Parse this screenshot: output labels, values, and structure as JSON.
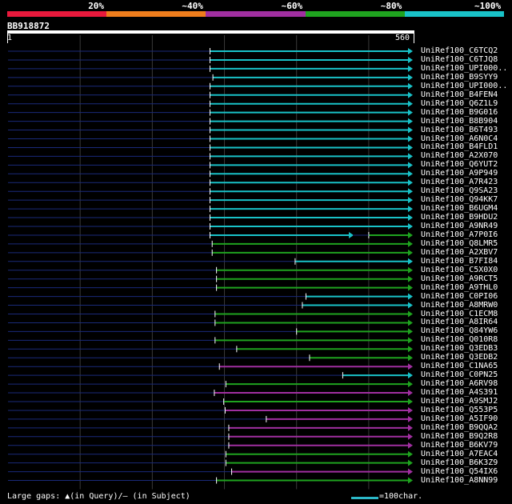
{
  "legend": {
    "colors": [
      "#e8193c",
      "#ee7d1c",
      "#a02fa0",
      "#1fa31f",
      "#19c2c8"
    ],
    "labels": [
      "20%",
      "~40%",
      "~60%",
      "~80%",
      "~100%"
    ]
  },
  "query": {
    "title": "BB918872",
    "start_label": "1",
    "end_label": "560"
  },
  "footer": {
    "gaps_text": "Large gaps: ▲(in Query)/– (in Subject)",
    "scale_text": "=100char."
  },
  "chart_data": {
    "type": "alignment",
    "query_length": 560,
    "grid_positions": [
      100,
      200,
      300,
      400,
      500
    ],
    "hits": [
      {
        "label": "UniRef100_C6TCQ2",
        "start": 280,
        "end": 560,
        "identity": "~100%"
      },
      {
        "label": "UniRef100_C6TJQ8",
        "start": 280,
        "end": 560,
        "identity": "~100%"
      },
      {
        "label": "UniRef100_UPI000..",
        "start": 280,
        "end": 560,
        "identity": "~100%"
      },
      {
        "label": "UniRef100_B9SYY9",
        "start": 284,
        "end": 560,
        "identity": "~100%"
      },
      {
        "label": "UniRef100_UPI000..",
        "start": 280,
        "end": 560,
        "identity": "~100%"
      },
      {
        "label": "UniRef100_B4FEN4",
        "start": 280,
        "end": 560,
        "identity": "~100%"
      },
      {
        "label": "UniRef100_Q6Z1L9",
        "start": 280,
        "end": 560,
        "identity": "~100%"
      },
      {
        "label": "UniRef100_B9G016",
        "start": 280,
        "end": 560,
        "identity": "~100%"
      },
      {
        "label": "UniRef100_B8B904",
        "start": 280,
        "end": 560,
        "identity": "~100%"
      },
      {
        "label": "UniRef100_B6T493",
        "start": 280,
        "end": 560,
        "identity": "~100%"
      },
      {
        "label": "UniRef100_A6N0C4",
        "start": 280,
        "end": 560,
        "identity": "~100%"
      },
      {
        "label": "UniRef100_B4FLD1",
        "start": 280,
        "end": 560,
        "identity": "~100%"
      },
      {
        "label": "UniRef100_A2X070",
        "start": 280,
        "end": 560,
        "identity": "~100%"
      },
      {
        "label": "UniRef100_Q6YUT2",
        "start": 280,
        "end": 560,
        "identity": "~100%"
      },
      {
        "label": "UniRef100_A9P949",
        "start": 280,
        "end": 560,
        "identity": "~100%"
      },
      {
        "label": "UniRef100_A7R423",
        "start": 280,
        "end": 560,
        "identity": "~100%"
      },
      {
        "label": "UniRef100_Q9SA23",
        "start": 280,
        "end": 560,
        "identity": "~100%"
      },
      {
        "label": "UniRef100_Q94KK7",
        "start": 280,
        "end": 560,
        "identity": "~100%"
      },
      {
        "label": "UniRef100_B6UGM4",
        "start": 280,
        "end": 560,
        "identity": "~100%"
      },
      {
        "label": "UniRef100_B9HDU2",
        "start": 280,
        "end": 560,
        "identity": "~100%"
      },
      {
        "label": "UniRef100_A9NR49",
        "start": 280,
        "end": 560,
        "identity": "~100%"
      },
      {
        "label": "UniRef100_A7P0I6",
        "segments": [
          {
            "start": 280,
            "end": 478,
            "identity": "~100%"
          },
          {
            "start": 500,
            "end": 560,
            "identity": "~80%"
          }
        ]
      },
      {
        "label": "UniRef100_Q8LMR5",
        "start": 283,
        "end": 560,
        "identity": "~80%"
      },
      {
        "label": "UniRef100_A2XBV7",
        "start": 283,
        "end": 560,
        "identity": "~80%"
      },
      {
        "label": "UniRef100_B7FI84",
        "start": 398,
        "end": 560,
        "identity": "~100%"
      },
      {
        "label": "UniRef100_C5X0X0",
        "start": 289,
        "end": 560,
        "identity": "~80%"
      },
      {
        "label": "UniRef100_A9RCT5",
        "start": 289,
        "end": 560,
        "identity": "~80%"
      },
      {
        "label": "UniRef100_A9THL0",
        "start": 289,
        "end": 560,
        "identity": "~80%"
      },
      {
        "label": "UniRef100_C0PI06",
        "start": 413,
        "end": 560,
        "identity": "~100%"
      },
      {
        "label": "UniRef100_A8MRW0",
        "start": 408,
        "end": 560,
        "identity": "~100%"
      },
      {
        "label": "UniRef100_C1ECM8",
        "start": 287,
        "end": 560,
        "identity": "~80%"
      },
      {
        "label": "UniRef100_A8IR64",
        "start": 287,
        "end": 560,
        "identity": "~80%"
      },
      {
        "label": "UniRef100_Q84YW6",
        "start": 400,
        "end": 560,
        "identity": "~80%"
      },
      {
        "label": "UniRef100_Q010R8",
        "start": 287,
        "end": 560,
        "identity": "~80%"
      },
      {
        "label": "UniRef100_Q3EDB3",
        "start": 317,
        "end": 560,
        "identity": "~80%"
      },
      {
        "label": "UniRef100_Q3EDB2",
        "start": 418,
        "end": 560,
        "identity": "~80%"
      },
      {
        "label": "UniRef100_C1NA65",
        "start": 293,
        "end": 560,
        "identity": "~60%"
      },
      {
        "label": "UniRef100_C0PN25",
        "start": 464,
        "end": 560,
        "identity": "~100%"
      },
      {
        "label": "UniRef100_A6RV98",
        "start": 302,
        "end": 560,
        "identity": "~80%"
      },
      {
        "label": "UniRef100_A4S391",
        "start": 286,
        "end": 560,
        "identity": "~60%"
      },
      {
        "label": "UniRef100_A9SMJ2",
        "start": 299,
        "end": 560,
        "identity": "~80%"
      },
      {
        "label": "UniRef100_Q553P5",
        "start": 301,
        "end": 560,
        "identity": "~60%"
      },
      {
        "label": "UniRef100_A5IF90",
        "start": 358,
        "end": 560,
        "identity": "~60%"
      },
      {
        "label": "UniRef100_B9QQA2",
        "start": 306,
        "end": 560,
        "identity": "~60%"
      },
      {
        "label": "UniRef100_B9Q2R8",
        "start": 306,
        "end": 560,
        "identity": "~60%"
      },
      {
        "label": "UniRef100_B6KV79",
        "start": 306,
        "end": 560,
        "identity": "~60%"
      },
      {
        "label": "UniRef100_A7EAC4",
        "start": 302,
        "end": 560,
        "identity": "~80%"
      },
      {
        "label": "UniRef100_B6K3Z9",
        "start": 302,
        "end": 560,
        "identity": "~80%"
      },
      {
        "label": "UniRef100_Q54IX6",
        "start": 310,
        "end": 560,
        "identity": "~60%"
      },
      {
        "label": "UniRef100_A8NN99",
        "start": 289,
        "end": 560,
        "identity": "~80%"
      }
    ]
  }
}
